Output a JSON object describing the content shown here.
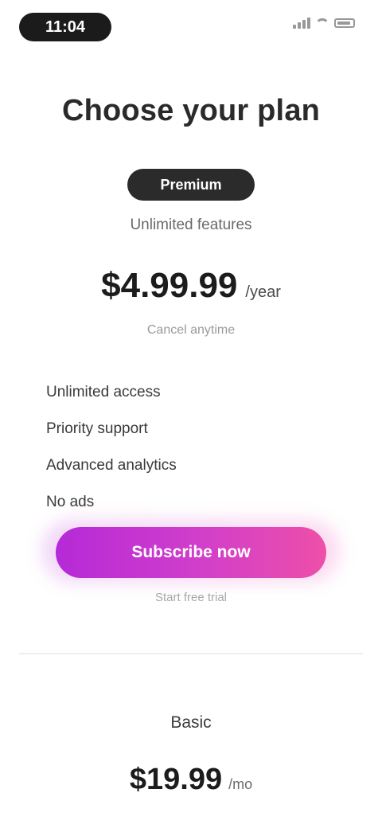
{
  "status_bar": {
    "time": "11:04"
  },
  "heading": "Choose your plan",
  "plans": [
    {
      "badge": "Premium",
      "subtitle": "Unlimited features",
      "price": "$4.99.99",
      "period": "/year",
      "note": "Cancel anytime",
      "features": [
        "Unlimited access",
        "Priority support",
        "Advanced analytics",
        "No ads"
      ],
      "cta_label": "Subscribe now",
      "cta_caption": "Start free trial"
    },
    {
      "title": "Basic",
      "price": "$19.99",
      "period": "/mo"
    }
  ],
  "colors": {
    "cta_gradient_start": "#b52ad8",
    "cta_gradient_end": "#ee4fa8",
    "badge_bg": "#2b2b2b"
  }
}
